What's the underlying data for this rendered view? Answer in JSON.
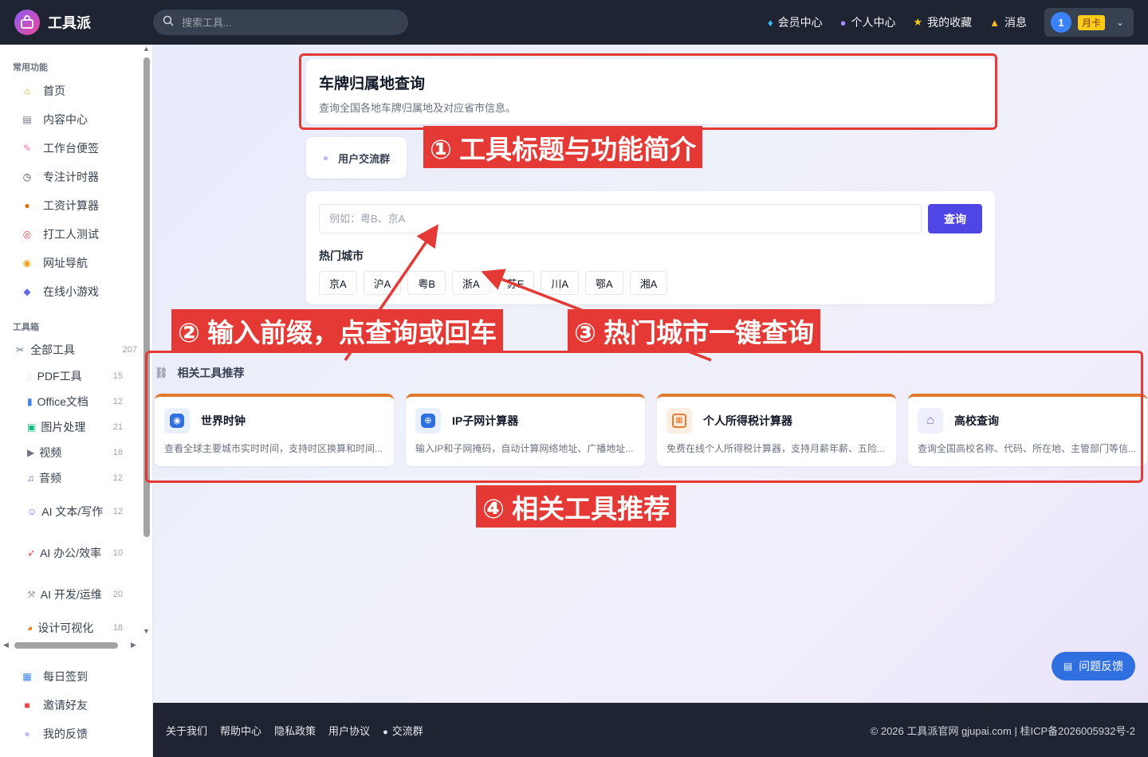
{
  "app": {
    "name": "工具派"
  },
  "search": {
    "placeholder": "搜索工具..."
  },
  "topnav": [
    {
      "label": "会员中心",
      "icon": "diamond-icon"
    },
    {
      "label": "个人中心",
      "icon": "person-icon"
    },
    {
      "label": "我的收藏",
      "icon": "star-icon"
    },
    {
      "label": "消息",
      "icon": "bell-icon"
    }
  ],
  "user": {
    "avatar_text": "1",
    "plan": "月卡"
  },
  "sidebar": {
    "section_common": "常用功能",
    "common": [
      {
        "label": "首页",
        "icon": "home-icon"
      },
      {
        "label": "内容中心",
        "icon": "newspaper-icon"
      },
      {
        "label": "工作台便签",
        "icon": "memo-icon"
      },
      {
        "label": "专注计时器",
        "icon": "timer-icon"
      },
      {
        "label": "工资计算器",
        "icon": "money-bag-icon"
      },
      {
        "label": "打工人测试",
        "icon": "target-icon"
      },
      {
        "label": "网址导航",
        "icon": "compass-icon"
      },
      {
        "label": "在线小游戏",
        "icon": "gamepad-icon"
      }
    ],
    "section_tools": "工具箱",
    "all_tools": {
      "label": "全部工具",
      "count": "207"
    },
    "tools": [
      {
        "label": "PDF工具",
        "count": "15"
      },
      {
        "label": "Office文档",
        "count": "12"
      },
      {
        "label": "图片处理",
        "count": "21"
      },
      {
        "label": "视频",
        "count": "18"
      },
      {
        "label": "音频",
        "count": "12"
      },
      {
        "label": "AI 文本/写作",
        "count": "12"
      },
      {
        "label": "AI 办公/效率",
        "count": "10"
      },
      {
        "label": "AI 开发/运维",
        "count": "20"
      },
      {
        "label": "设计可视化",
        "count": "18"
      }
    ],
    "bottom": [
      {
        "label": "每日签到",
        "icon": "calendar-icon"
      },
      {
        "label": "邀请好友",
        "icon": "gift-icon"
      },
      {
        "label": "我的反馈",
        "icon": "chat-bubble-icon"
      }
    ]
  },
  "page": {
    "title": "车牌归属地查询",
    "subtitle": "查询全国各地车牌归属地及对应省市信息。",
    "user_group": "用户交流群"
  },
  "query": {
    "placeholder": "例如：粤B、京A",
    "value": "",
    "button": "查询",
    "hot_title": "热门城市",
    "hot_cities": [
      "京A",
      "沪A",
      "粤B",
      "浙A",
      "苏E",
      "川A",
      "鄂A",
      "湘A"
    ]
  },
  "related": {
    "title": "相关工具推荐",
    "tools": [
      {
        "name": "世界时钟",
        "desc": "查看全球主要城市实时时间，支持时区换算和时间...",
        "icon": "globe-icon",
        "color": "#2f6fe0"
      },
      {
        "name": "IP子网计算器",
        "desc": "输入IP和子网掩码，自动计算网络地址、广播地址...",
        "icon": "network-icon",
        "color": "#2f6fe0"
      },
      {
        "name": "个人所得税计算器",
        "desc": "免费在线个人所得税计算器，支持月薪年薪、五险...",
        "icon": "calculator-icon",
        "color": "#ea7a2e"
      },
      {
        "name": "高校查询",
        "desc": "查询全国高校名称、代码、所在地、主管部门等信...",
        "icon": "school-icon",
        "color": "#6d74e8"
      }
    ]
  },
  "feedback": {
    "label": "问题反馈"
  },
  "footer": {
    "links": [
      "关于我们",
      "帮助中心",
      "隐私政策",
      "用户协议",
      "交流群"
    ],
    "copyright": "© 2026 工具派官网 gjupai.com | 桂ICP备2026005932号-2"
  },
  "annotations": [
    {
      "label": "① 工具标题与功能简介"
    },
    {
      "label": "② 输入前缀，点查询或回车"
    },
    {
      "label": "③ 热门城市一键查询"
    },
    {
      "label": "④ 相关工具推荐"
    }
  ],
  "colors": {
    "accent": "#4f46e5",
    "annotation": "#e53935",
    "dark": "#1e2432"
  }
}
